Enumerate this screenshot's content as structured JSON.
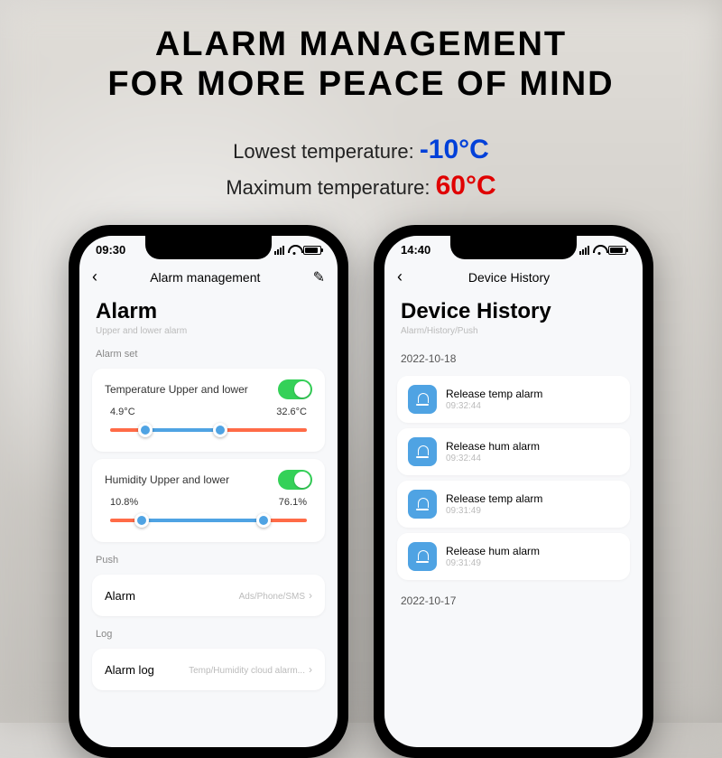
{
  "header": {
    "line1": "ALARM MANAGEMENT",
    "line2": "FOR MORE PEACE OF MIND"
  },
  "temps": {
    "low_label": "Lowest temperature: ",
    "low_value": "-10°C",
    "max_label": "Maximum temperature: ",
    "max_value": "60°C"
  },
  "phone1": {
    "time": "09:30",
    "nav_title": "Alarm management",
    "page_title": "Alarm",
    "page_subtitle": "Upper and lower alarm",
    "section_set": "Alarm set",
    "temp": {
      "title": "Temperature Upper and lower",
      "low": "4.9°C",
      "high": "32.6°C",
      "low_pct": 18,
      "high_pct": 56
    },
    "hum": {
      "title": "Humidity Upper and lower",
      "low": "10.8%",
      "high": "76.1%",
      "low_pct": 16,
      "high_pct": 78
    },
    "push_section": "Push",
    "push_label": "Alarm",
    "push_value": "Ads/Phone/SMS",
    "log_section": "Log",
    "log_label": "Alarm log",
    "log_value": "Temp/Humidity cloud alarm..."
  },
  "phone2": {
    "time": "14:40",
    "nav_title": "Device History",
    "page_title": "Device History",
    "page_subtitle": "Alarm/History/Push",
    "date1": "2022-10-18",
    "date2": "2022-10-17",
    "items": [
      {
        "title": "Release temp alarm",
        "time": "09:32:44"
      },
      {
        "title": "Release hum alarm",
        "time": "09:32:44"
      },
      {
        "title": "Release temp alarm",
        "time": "09:31:49"
      },
      {
        "title": "Release hum alarm",
        "time": "09:31:49"
      }
    ]
  }
}
